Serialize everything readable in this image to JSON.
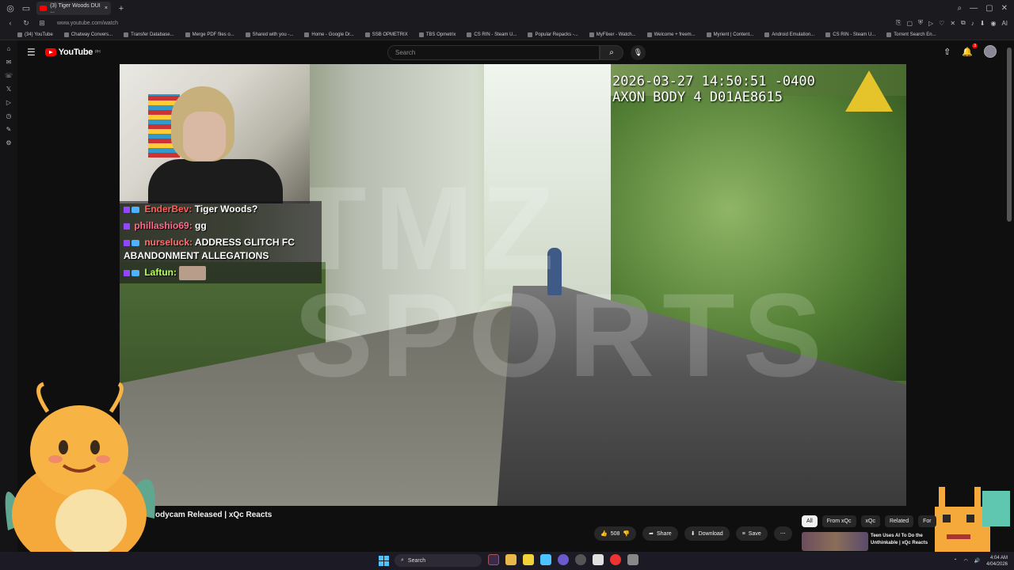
{
  "browser": {
    "tab_title": "(3) Tiger Woods DUI ...",
    "url": "www.youtube.com/watch",
    "bookmarks": [
      "(34) YouTube",
      "Chatway Convers...",
      "Transfer Database...",
      "Merge PDF files o...",
      "Shared with you -...",
      "Home - Google Dr...",
      "SSB OPMETRIX",
      "TBS Opmetrix",
      "CS RIN - Steam U...",
      "Popular Repacks -...",
      "MyFlixer - Watch...",
      "Welcome + freem...",
      "Myrient | Content...",
      "Android Emulation...",
      "CS RIN - Steam U...",
      "Torrent Search En..."
    ],
    "ai_label": "AI"
  },
  "youtube": {
    "logo_text": "YouTube",
    "logo_sup": "PH",
    "search_placeholder": "Search",
    "notification_count": "3"
  },
  "video": {
    "timestamp_line1": "2026-03-27 14:50:51 -0400",
    "timestamp_line2": "AXON BODY 4 D01AE8615",
    "watermark_line1": "TMZ",
    "watermark_line2": "SPORTS"
  },
  "chat": [
    {
      "user": "EnderBev:",
      "msg": "Tiger Woods?"
    },
    {
      "user": "phillashio69:",
      "msg": "gg"
    },
    {
      "user": "nurseluck:",
      "msg": "ADDRESS GLITCH FC ABANDONMENT ALLEGATIONS"
    },
    {
      "user": "Laftun:",
      "msg": ""
    }
  ],
  "below_video": {
    "title": "odycam Released | xQc Reacts",
    "like_count": "508",
    "share_label": "Share",
    "download_label": "Download",
    "save_label": "Save"
  },
  "chips": [
    "All",
    "From xQc",
    "xQc",
    "Related",
    "For"
  ],
  "recommendation": {
    "title": "Teen Uses AI To Do the Unthinkable | xQc Reacts"
  },
  "taskbar": {
    "search_label": "Search",
    "time": "4:04 AM",
    "date": "4/04/2026"
  },
  "colors": {
    "yt_red": "#ff0000",
    "accent": "#4cc2ff",
    "background": "#0f0f0f"
  }
}
